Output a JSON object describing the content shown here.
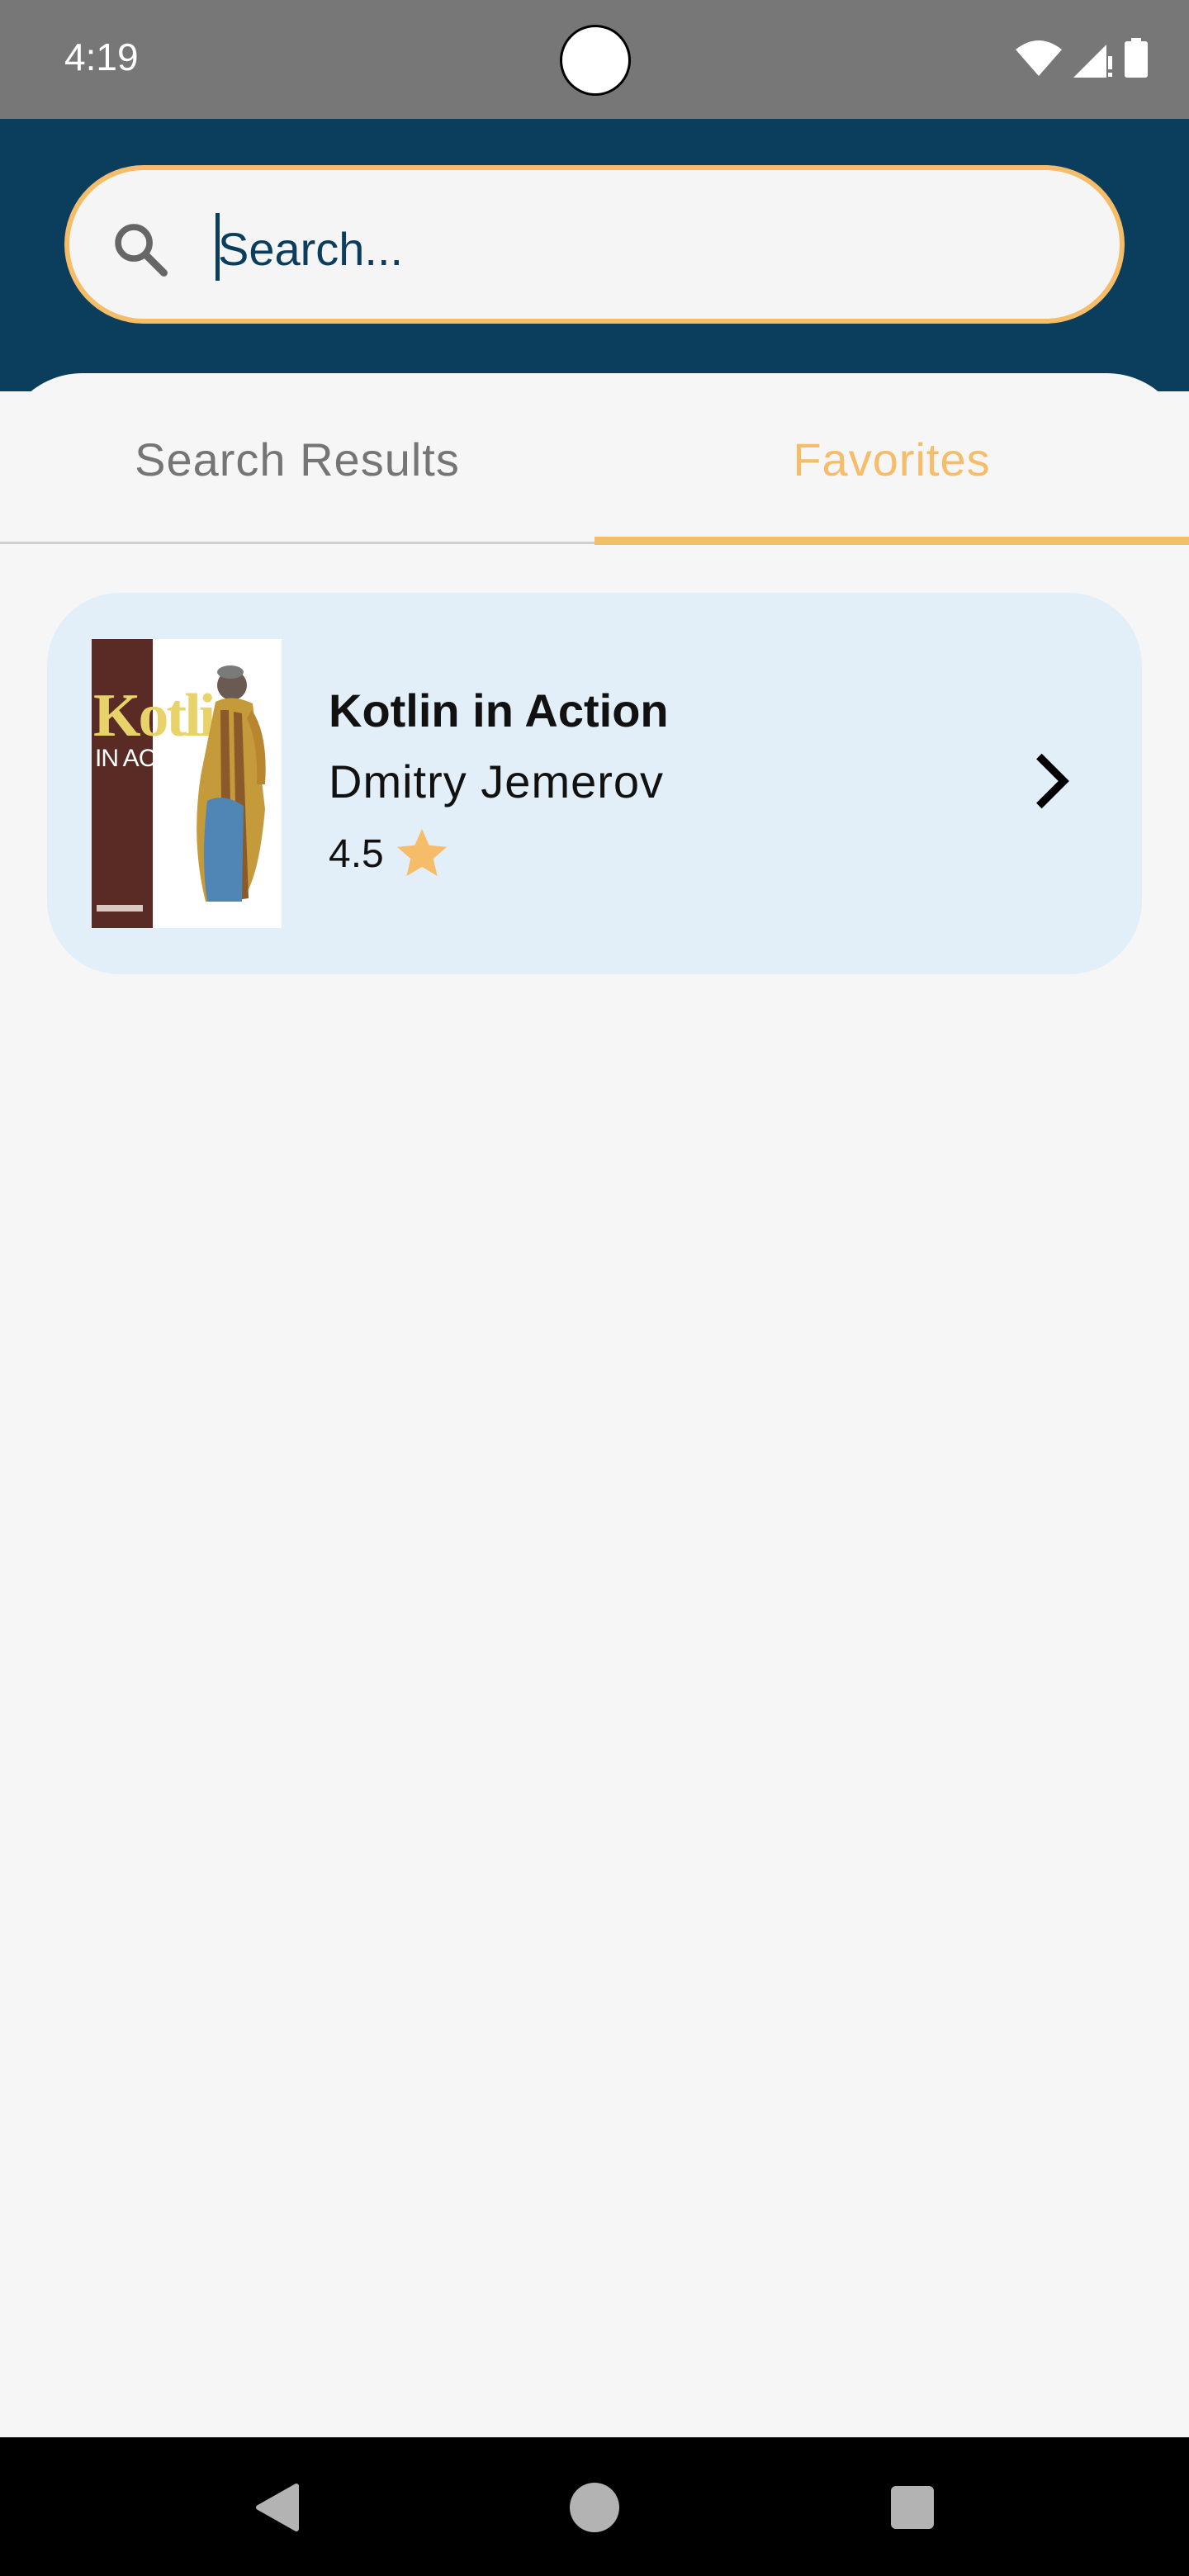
{
  "status_bar": {
    "time": "4:19",
    "icons": [
      "wifi-icon",
      "signal-icon",
      "battery-icon"
    ]
  },
  "search": {
    "placeholder": "Search...",
    "value": "",
    "icon": "search-icon"
  },
  "tabs": [
    {
      "label": "Search Results",
      "selected": false
    },
    {
      "label": "Favorites",
      "selected": true
    }
  ],
  "favorites": [
    {
      "title": "Kotlin in Action",
      "author": "Dmitry Jemerov",
      "rating": "4.5",
      "cover": {
        "title": "Kotlin",
        "subtitle": "IN ACTION"
      }
    }
  ],
  "colors": {
    "header_bg": "#0b3d5c",
    "accent": "#f5bd6a",
    "card_bg": "#e2eff8",
    "page_bg": "#f6f6f6"
  },
  "nav_bar": {
    "buttons": [
      "back-icon",
      "home-icon",
      "recents-icon"
    ]
  }
}
